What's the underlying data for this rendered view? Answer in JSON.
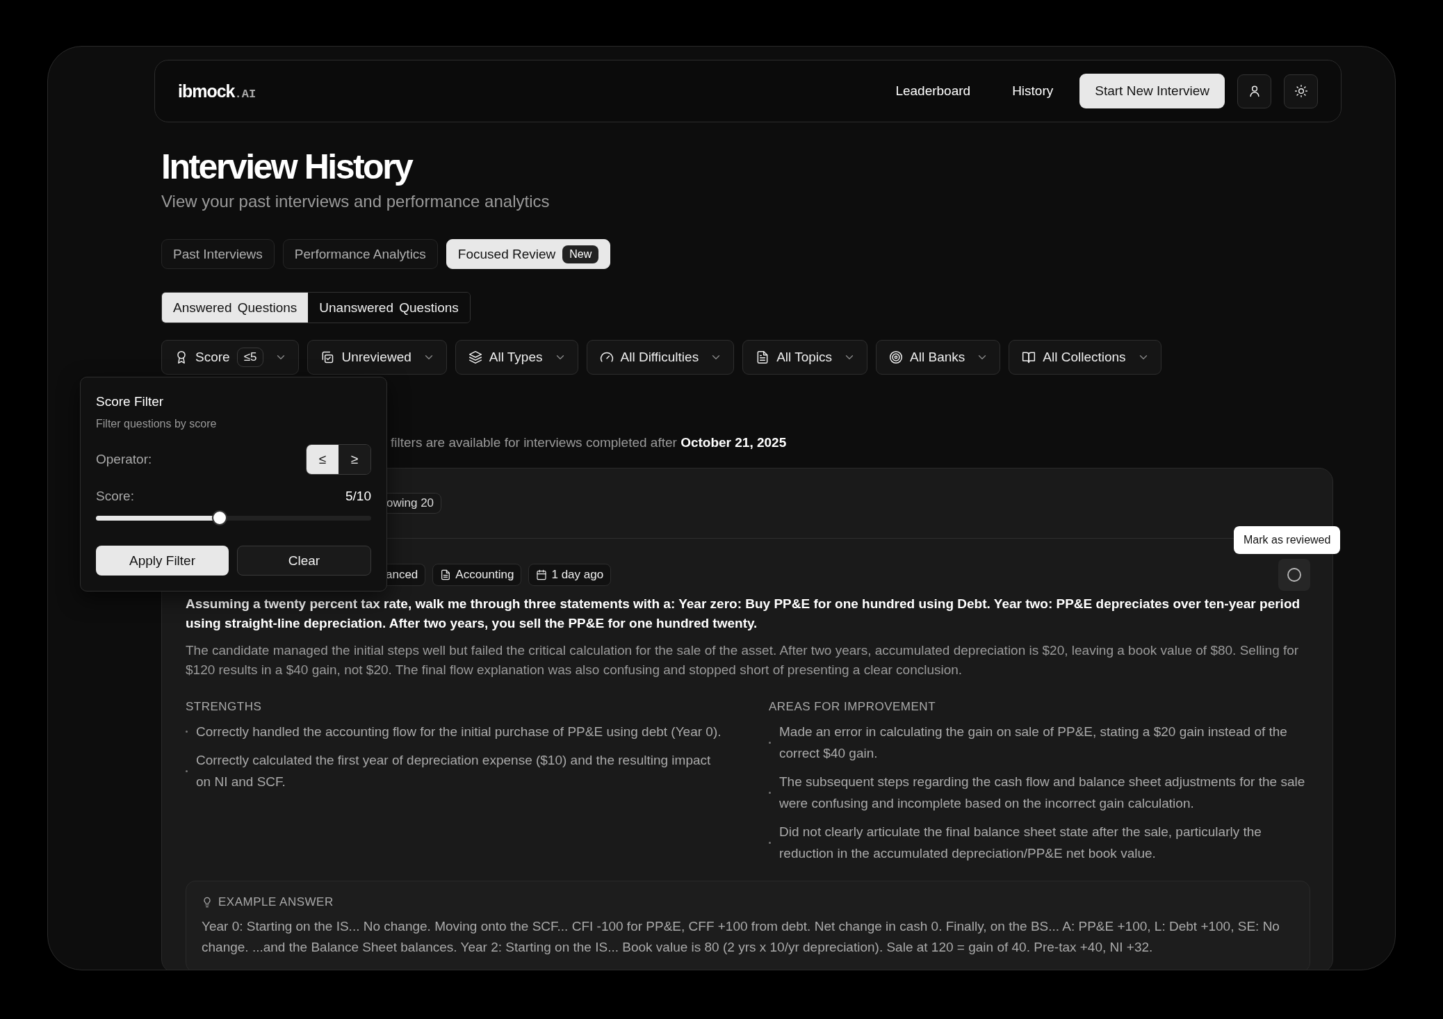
{
  "header": {
    "logo": "ibmock",
    "logo_suffix": ".AI",
    "nav": [
      "Leaderboard",
      "History"
    ],
    "cta": "Start New Interview"
  },
  "page": {
    "title": "Interview History",
    "subtitle": "View your past interviews and performance analytics"
  },
  "tabs": [
    {
      "label": "Past Interviews",
      "selected": false
    },
    {
      "label": "Performance Analytics",
      "selected": false
    },
    {
      "label": "Focused Review",
      "selected": true,
      "badge": "New"
    }
  ],
  "segments": [
    {
      "label": "Answered Questions",
      "selected": true
    },
    {
      "label": "Unanswered Questions",
      "selected": false
    }
  ],
  "filters": [
    {
      "label": "Score",
      "badge": "≤5"
    },
    {
      "label": "Unreviewed"
    },
    {
      "label": "All Types"
    },
    {
      "label": "All Difficulties"
    },
    {
      "label": "All Topics"
    },
    {
      "label": "All Banks"
    },
    {
      "label": "All Collections"
    }
  ],
  "info": "filters are available for interviews completed after **October 21, 2025**",
  "score_popover": {
    "title": "Score Filter",
    "description": "Filter questions by score",
    "operator_label": "Operator:",
    "operators": [
      {
        "label": "≤",
        "selected": true
      },
      {
        "label": "≥",
        "selected": false
      }
    ],
    "score_label": "Score:",
    "score_value": "5/10",
    "level": 0.45,
    "apply": "Apply Filter",
    "clear": "Clear"
  },
  "card": {
    "count": "owing 20",
    "tags": [
      "anced",
      "Accounting",
      "1 day ago"
    ],
    "tooltip": "Mark as reviewed",
    "reviewed": false,
    "question": "Assuming a twenty percent tax rate, walk me through three statements with a: Year zero: Buy PP&E for one hundred using Debt. Year two: PP&E depreciates over ten-year period using straight-line depreciation. After two years, you sell the PP&E for one hundred twenty.",
    "summary": "The candidate managed the initial steps well but failed the critical calculation for the sale of the asset. After two years, accumulated depreciation is $20, leaving a book value of $80. Selling for $120 results in a $40 gain, not $20. The final flow explanation was also confusing and stopped short of presenting a clear conclusion.",
    "strengths_title": "STRENGTHS",
    "strengths": [
      "Correctly handled the accounting flow for the initial purchase of PP&E using debt (Year 0).",
      "Correctly calculated the first year of depreciation expense ($10) and the resulting impact on NI and SCF."
    ],
    "improvements_title": "AREAS FOR IMPROVEMENT",
    "improvements": [
      "Made an error in calculating the gain on sale of PP&E, stating a $20 gain instead of the correct $40 gain.",
      "The subsequent steps regarding the cash flow and balance sheet adjustments for the sale were confusing and incomplete based on the incorrect gain calculation.",
      "Did not clearly articulate the final balance sheet state after the sale, particularly the reduction in the accumulated depreciation/PP&E net book value."
    ],
    "example_title": "EXAMPLE ANSWER",
    "example": "Year 0: Starting on the IS... No change. Moving onto the SCF... CFI -100 for PP&E, CFF +100 from debt. Net change in cash 0. Finally, on the BS... A: PP&E +100, L: Debt +100, SE: No change. ...and the Balance Sheet balances. Year 2: Starting on the IS... Book value is 80 (2 yrs x 10/yr depreciation). Sale at 120 = gain of 40. Pre-tax +40, NI +32."
  }
}
